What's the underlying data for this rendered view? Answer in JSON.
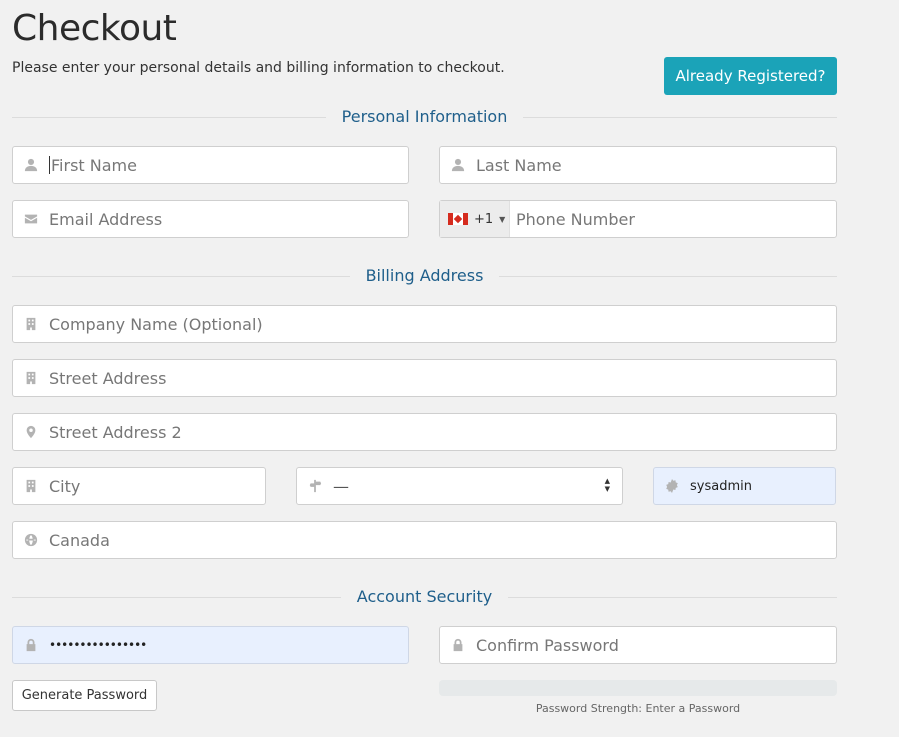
{
  "page": {
    "title": "Checkout",
    "intro": "Please enter your personal details and billing information to checkout.",
    "already_registered": "Already Registered?"
  },
  "sections": {
    "personal": "Personal Information",
    "billing": "Billing Address",
    "security": "Account Security"
  },
  "fields": {
    "first_name": {
      "placeholder": "First Name",
      "icon": "user-icon"
    },
    "last_name": {
      "placeholder": "Last Name",
      "icon": "user-icon"
    },
    "email": {
      "placeholder": "Email Address",
      "icon": "envelope-icon"
    },
    "phone": {
      "placeholder": "Phone Number",
      "country_flag": "canada-flag",
      "dial_code": "+1"
    },
    "company": {
      "placeholder": "Company Name (Optional)",
      "icon": "building-icon"
    },
    "street": {
      "placeholder": "Street Address",
      "icon": "building-icon"
    },
    "street2": {
      "placeholder": "Street Address 2",
      "icon": "map-marker-icon"
    },
    "city": {
      "placeholder": "City",
      "icon": "building-icon"
    },
    "state": {
      "value": "—",
      "icon": "signpost-icon"
    },
    "postcode": {
      "value": "sysadmin",
      "icon": "certificate-icon"
    },
    "country": {
      "placeholder": "Canada",
      "icon": "globe-icon"
    },
    "password": {
      "value": "••••••••••••••••",
      "icon": "lock-icon"
    },
    "confirm_password": {
      "placeholder": "Confirm Password",
      "icon": "lock-icon"
    }
  },
  "password_tools": {
    "generate": "Generate Password",
    "strength": "Password Strength: Enter a Password"
  },
  "colors": {
    "accent": "#1ba3b8",
    "section_label": "#1f5f8b",
    "autofill_bg": "#e8f0fe"
  }
}
